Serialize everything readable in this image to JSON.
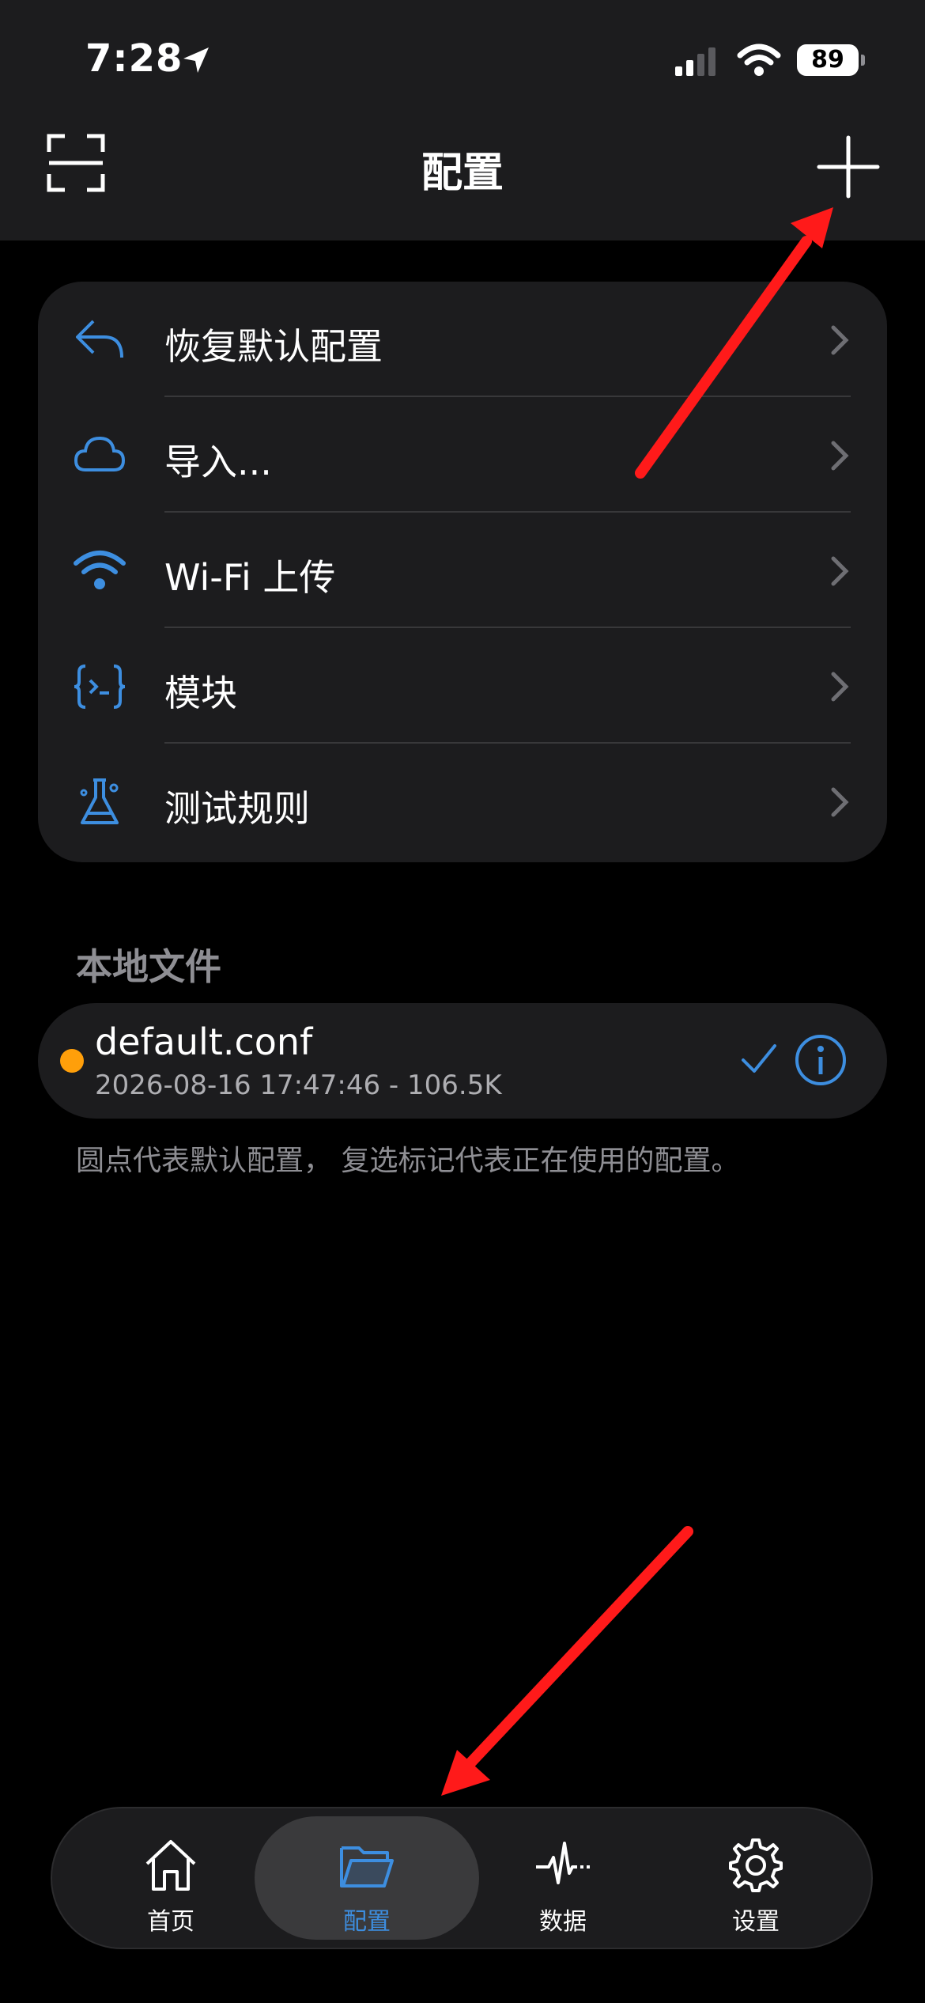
{
  "status_bar": {
    "time": "7:28",
    "battery": "89"
  },
  "nav": {
    "title": "配置"
  },
  "menu": [
    {
      "label": "恢复默认配置",
      "icon": "undo-arrow-icon"
    },
    {
      "label": "导入...",
      "icon": "cloud-icon"
    },
    {
      "label": "Wi-Fi 上传",
      "icon": "wifi-icon"
    },
    {
      "label": "模块",
      "icon": "module-braces-icon"
    },
    {
      "label": "测试规则",
      "icon": "flask-icon"
    }
  ],
  "local_files": {
    "section_title": "本地文件",
    "files": [
      {
        "name": "default.conf",
        "meta": "2026-08-16 17:47:46 - 106.5K"
      }
    ],
    "footnote": "圆点代表默认配置， 复选标记代表正在使用的配置。"
  },
  "tabbar": [
    {
      "label": "首页",
      "icon": "home-icon",
      "active": false
    },
    {
      "label": "配置",
      "icon": "folder-icon",
      "active": true
    },
    {
      "label": "数据",
      "icon": "activity-icon",
      "active": false
    },
    {
      "label": "设置",
      "icon": "gear-icon",
      "active": false
    }
  ],
  "colors": {
    "accent": "#3d8ee0",
    "default_dot": "#ff9f0a",
    "annotation_arrow": "#ff1a1a"
  }
}
